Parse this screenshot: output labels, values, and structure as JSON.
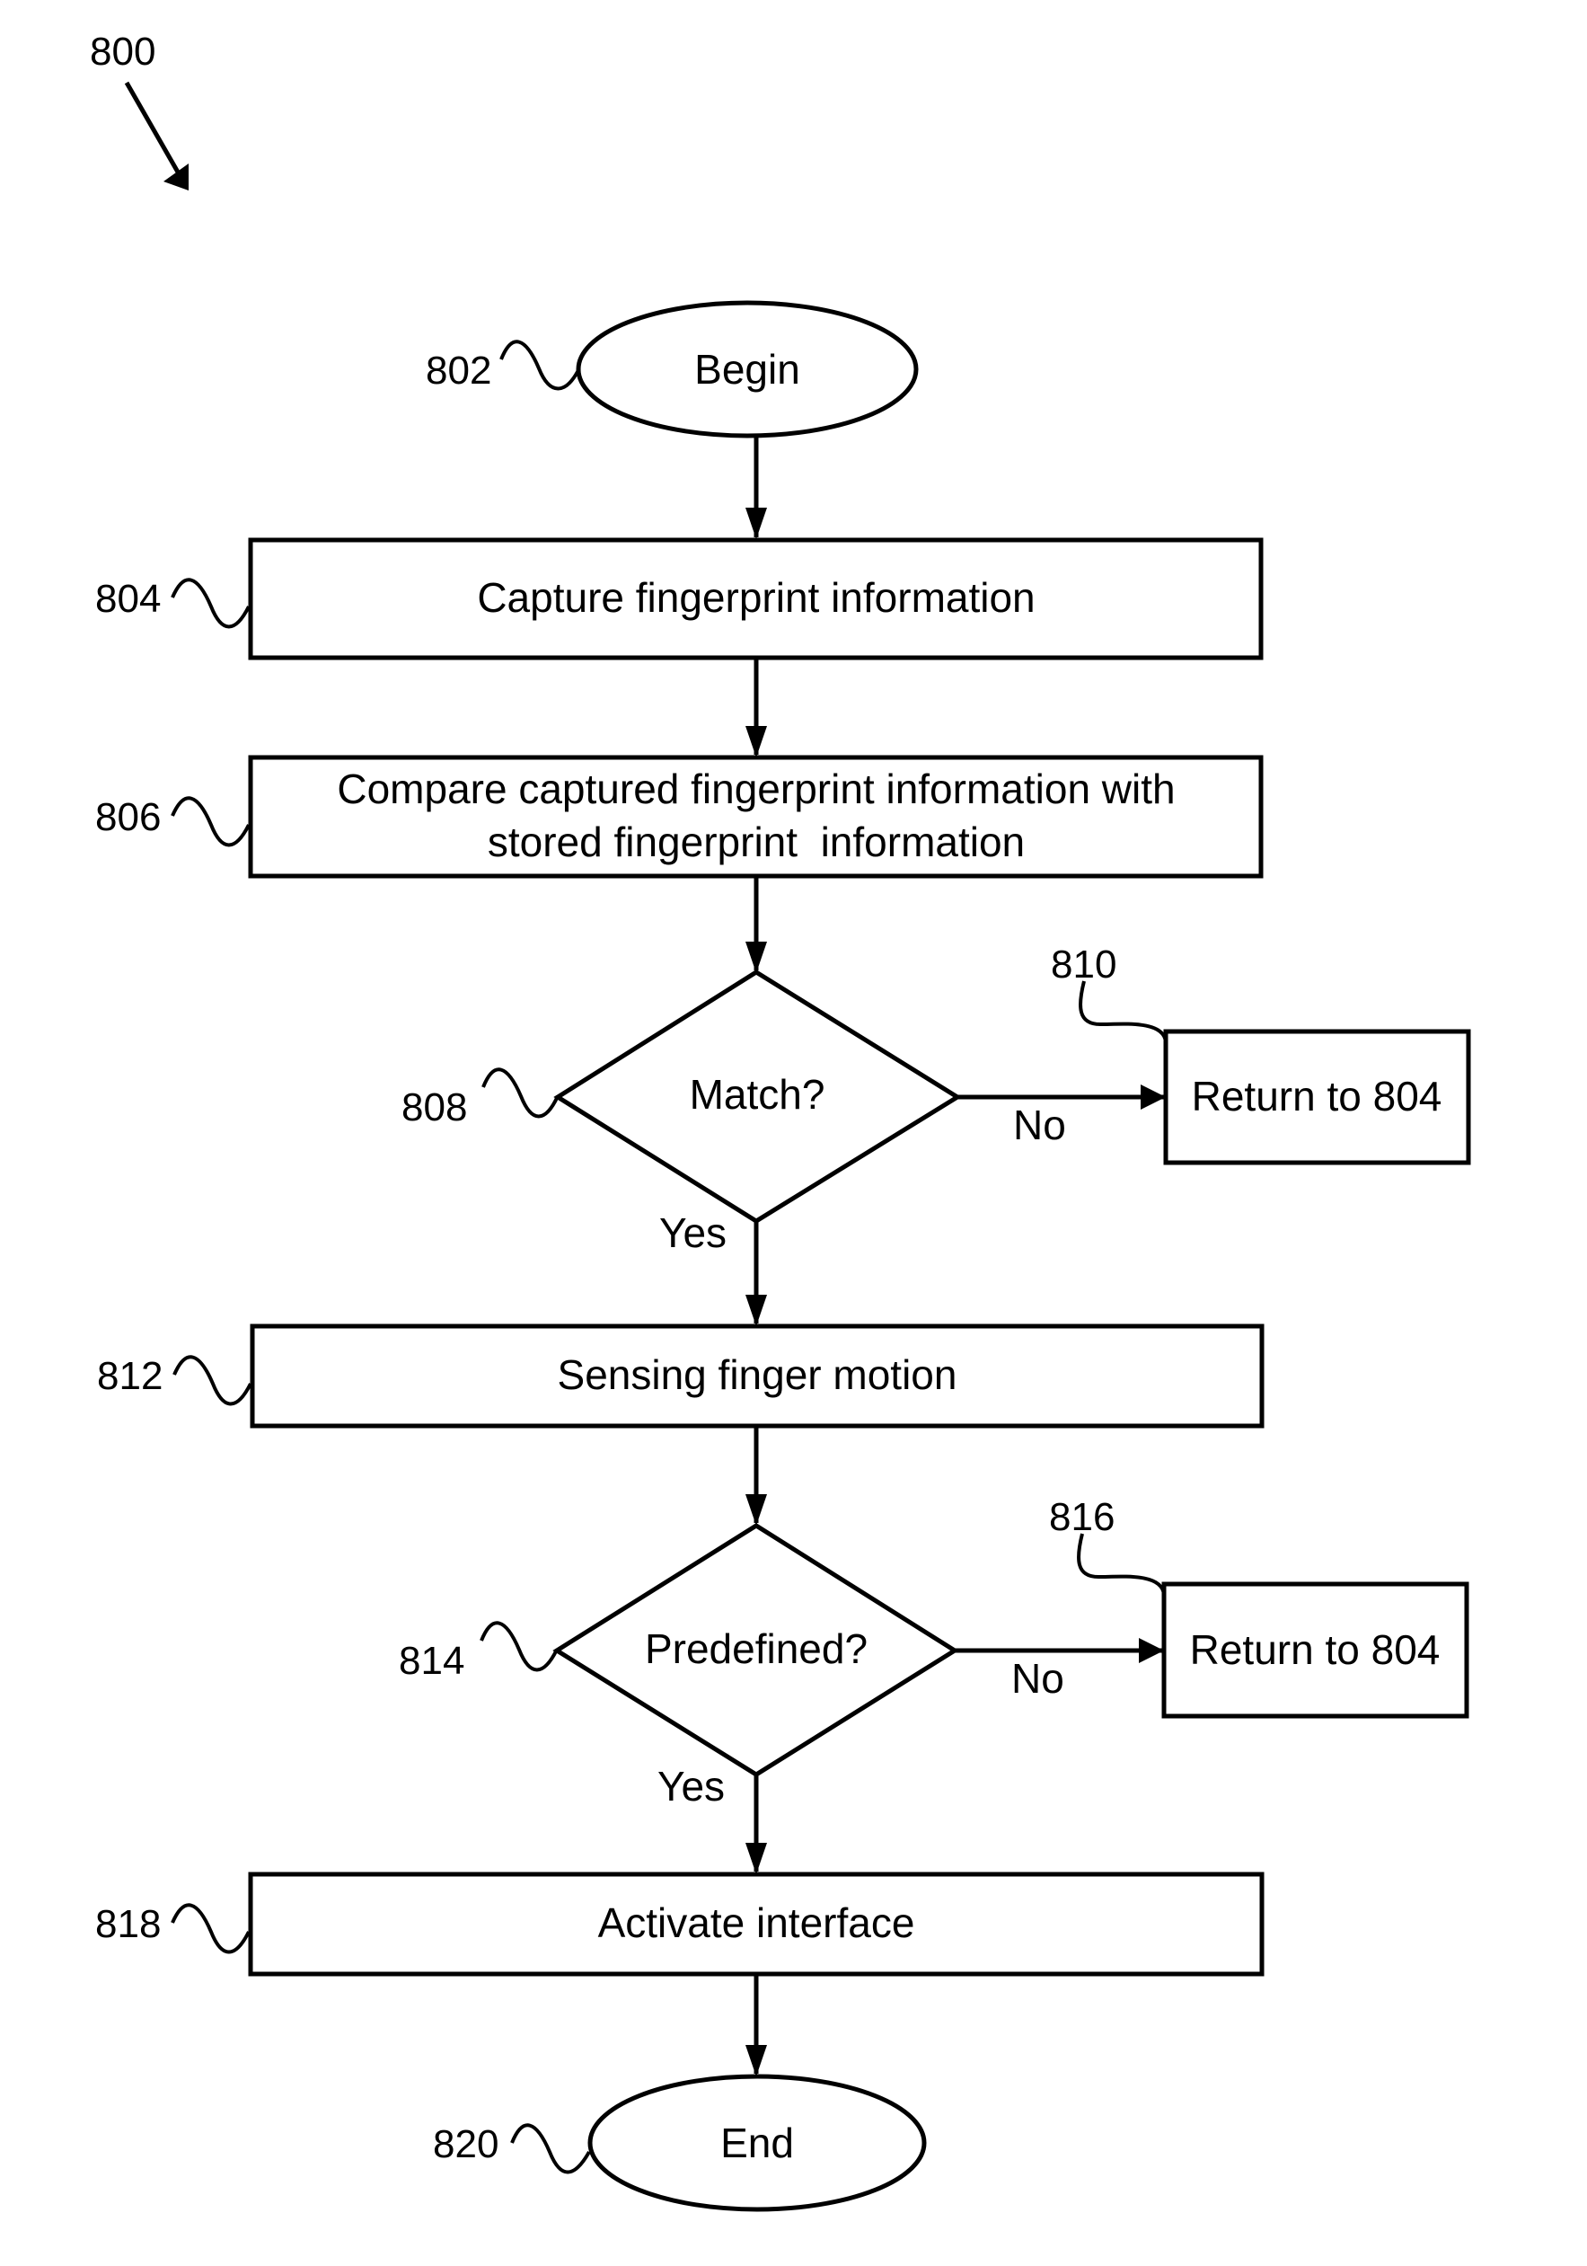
{
  "figure": {
    "ref": "800",
    "colors": {
      "stroke": "#000000",
      "background": "#ffffff"
    }
  },
  "nodes": {
    "begin": {
      "ref": "802",
      "label": "Begin",
      "shape": "oval"
    },
    "capture": {
      "ref": "804",
      "label": "Capture fingerprint information",
      "shape": "rect"
    },
    "compare": {
      "ref": "806",
      "lines": [
        "Compare captured fingerprint information with",
        "stored fingerprint  information"
      ],
      "shape": "rect"
    },
    "match": {
      "ref": "808",
      "label": "Match?",
      "shape": "diamond"
    },
    "return1": {
      "ref": "810",
      "label": "Return to 804",
      "shape": "rect"
    },
    "sensing": {
      "ref": "812",
      "label": "Sensing finger motion",
      "shape": "rect"
    },
    "predef": {
      "ref": "814",
      "label": "Predefined?",
      "shape": "diamond"
    },
    "return2": {
      "ref": "816",
      "label": "Return to 804",
      "shape": "rect"
    },
    "activate": {
      "ref": "818",
      "label": "Activate interface",
      "shape": "rect"
    },
    "end": {
      "ref": "820",
      "label": "End",
      "shape": "oval"
    }
  },
  "edges": {
    "match_no": "No",
    "match_yes": "Yes",
    "predef_no": "No",
    "predef_yes": "Yes"
  }
}
